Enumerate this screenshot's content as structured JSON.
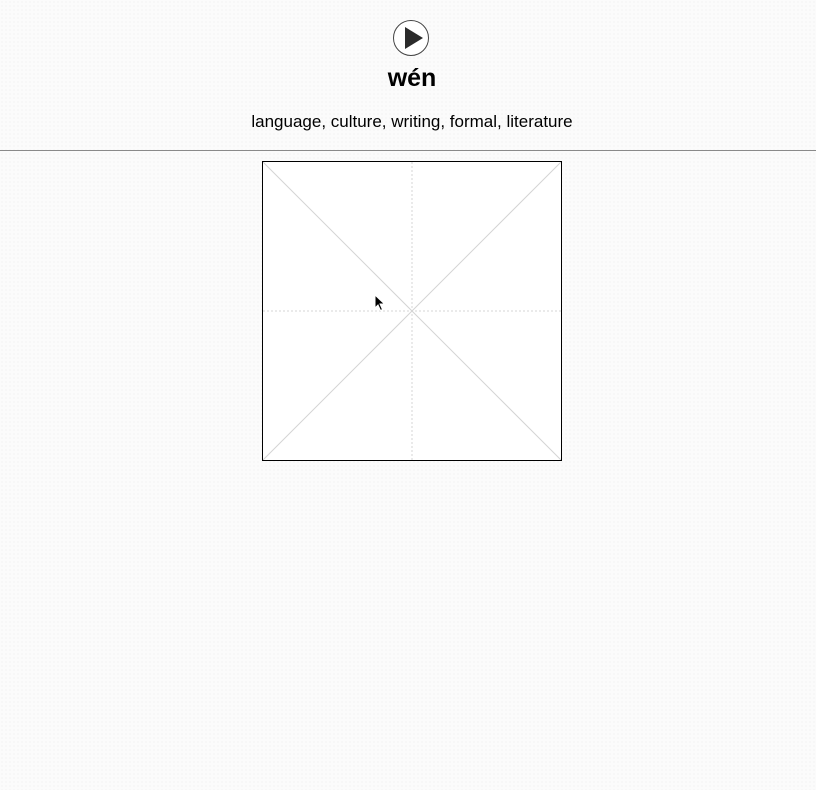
{
  "character": {
    "pinyin": "wén",
    "meaning": "language, culture, writing, formal, literature"
  },
  "audio": {
    "icon": "play-icon"
  },
  "writing_grid": {
    "guide_color": "#d4d4d4",
    "border_color": "#000000"
  }
}
